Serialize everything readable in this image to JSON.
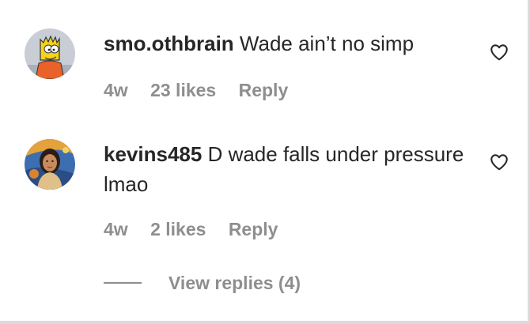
{
  "comments": [
    {
      "username": "smo.othbrain",
      "text": "Wade ain’t no simp",
      "time": "4w",
      "likes": "23 likes",
      "reply": "Reply",
      "avatar_icon": "bart-simpson-avatar",
      "like_icon": "heart-outline-icon"
    },
    {
      "username": "kevins485",
      "text": "D wade falls under pressure lmao",
      "time": "4w",
      "likes": "2 likes",
      "reply": "Reply",
      "avatar_icon": "illustrated-person-avatar",
      "like_icon": "heart-outline-icon"
    }
  ],
  "view_replies": {
    "label": "View replies (4)"
  },
  "colors": {
    "text_primary": "#262626",
    "text_secondary": "#8e8e8e",
    "divider": "#dbdbdb"
  }
}
